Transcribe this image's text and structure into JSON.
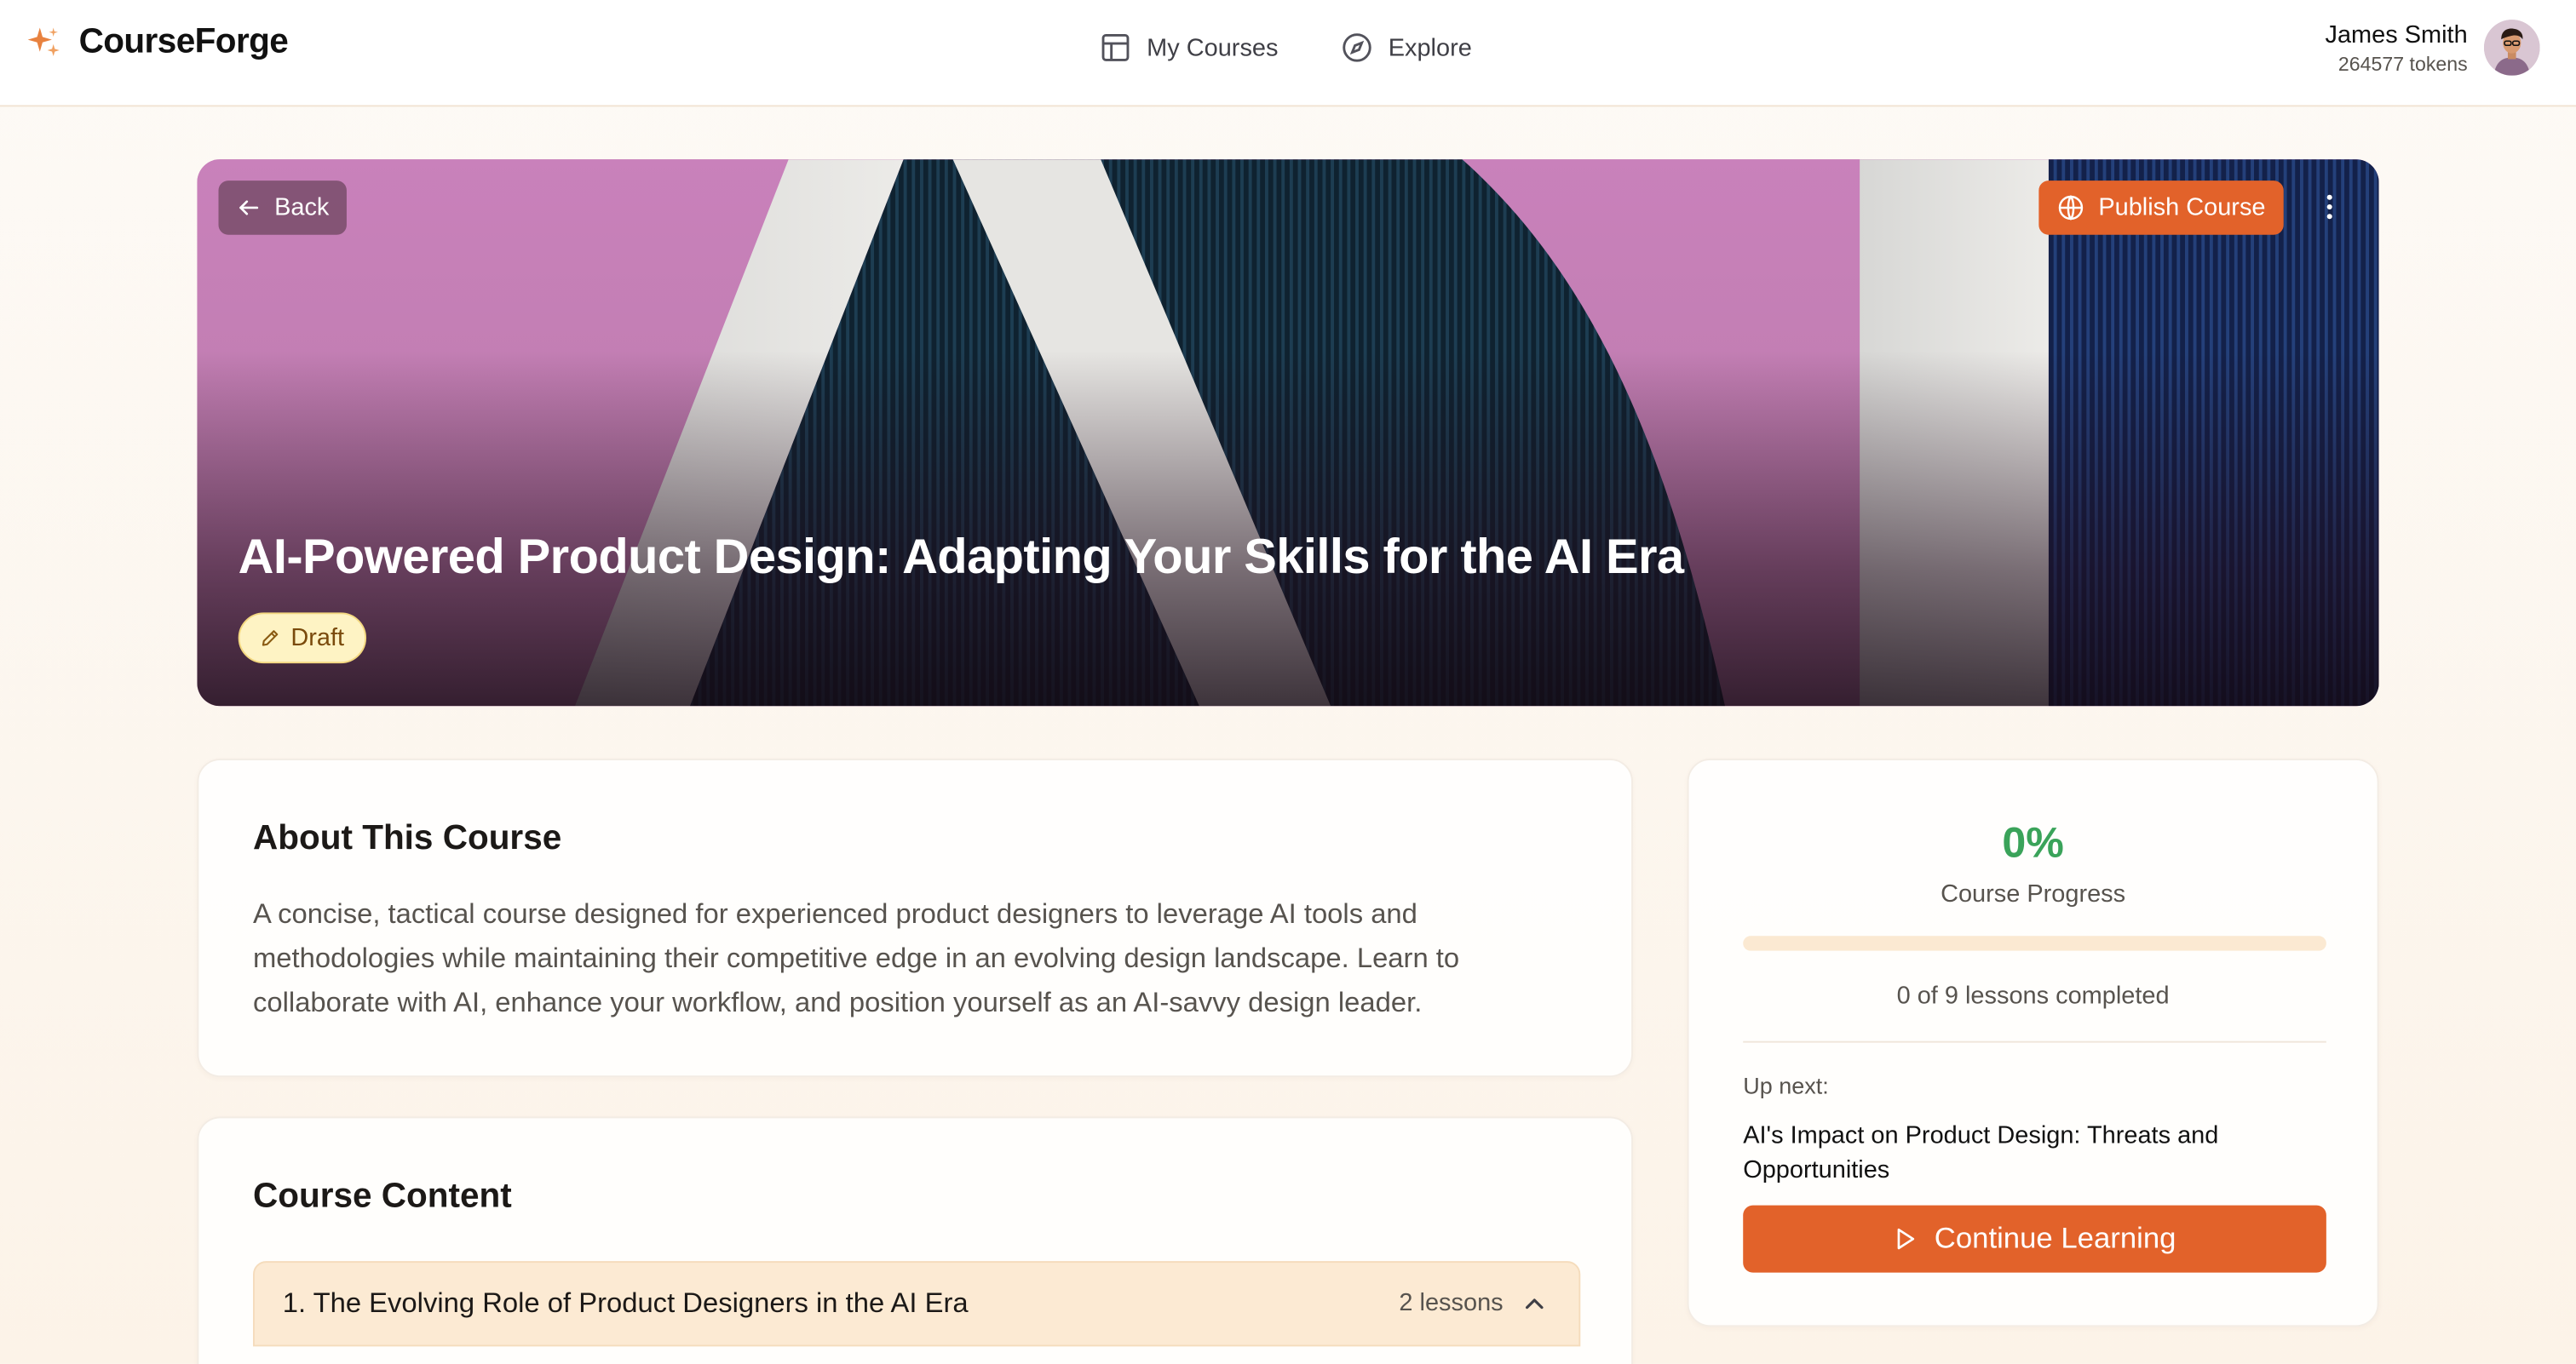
{
  "app": {
    "name": "CourseForge",
    "brand_color": "#e2622a"
  },
  "nav": {
    "my_courses": "My Courses",
    "explore": "Explore"
  },
  "user": {
    "name": "James Smith",
    "tokens": "264577 tokens"
  },
  "hero": {
    "back_label": "Back",
    "publish_label": "Publish Course",
    "title": "AI-Powered Product Design: Adapting Your Skills for the AI Era",
    "status": "Draft"
  },
  "about": {
    "heading": "About This Course",
    "description": "A concise, tactical course designed for experienced product designers to leverage AI tools and methodologies while maintaining their competitive edge in an evolving design landscape. Learn to collaborate with AI, enhance your workflow, and position yourself as an AI-savvy design leader."
  },
  "content": {
    "heading": "Course Content",
    "modules": [
      {
        "title": "1. The Evolving Role of Product Designers in the AI Era",
        "lessons": "2 lessons"
      }
    ]
  },
  "progress": {
    "percent_text": "0%",
    "percent_value": 0,
    "label": "Course Progress",
    "lessons_completed": "0 of 9 lessons completed",
    "up_next_label": "Up next:",
    "up_next_title": "AI's Impact on Product Design: Threats and Opportunities",
    "continue_label": "Continue Learning"
  }
}
